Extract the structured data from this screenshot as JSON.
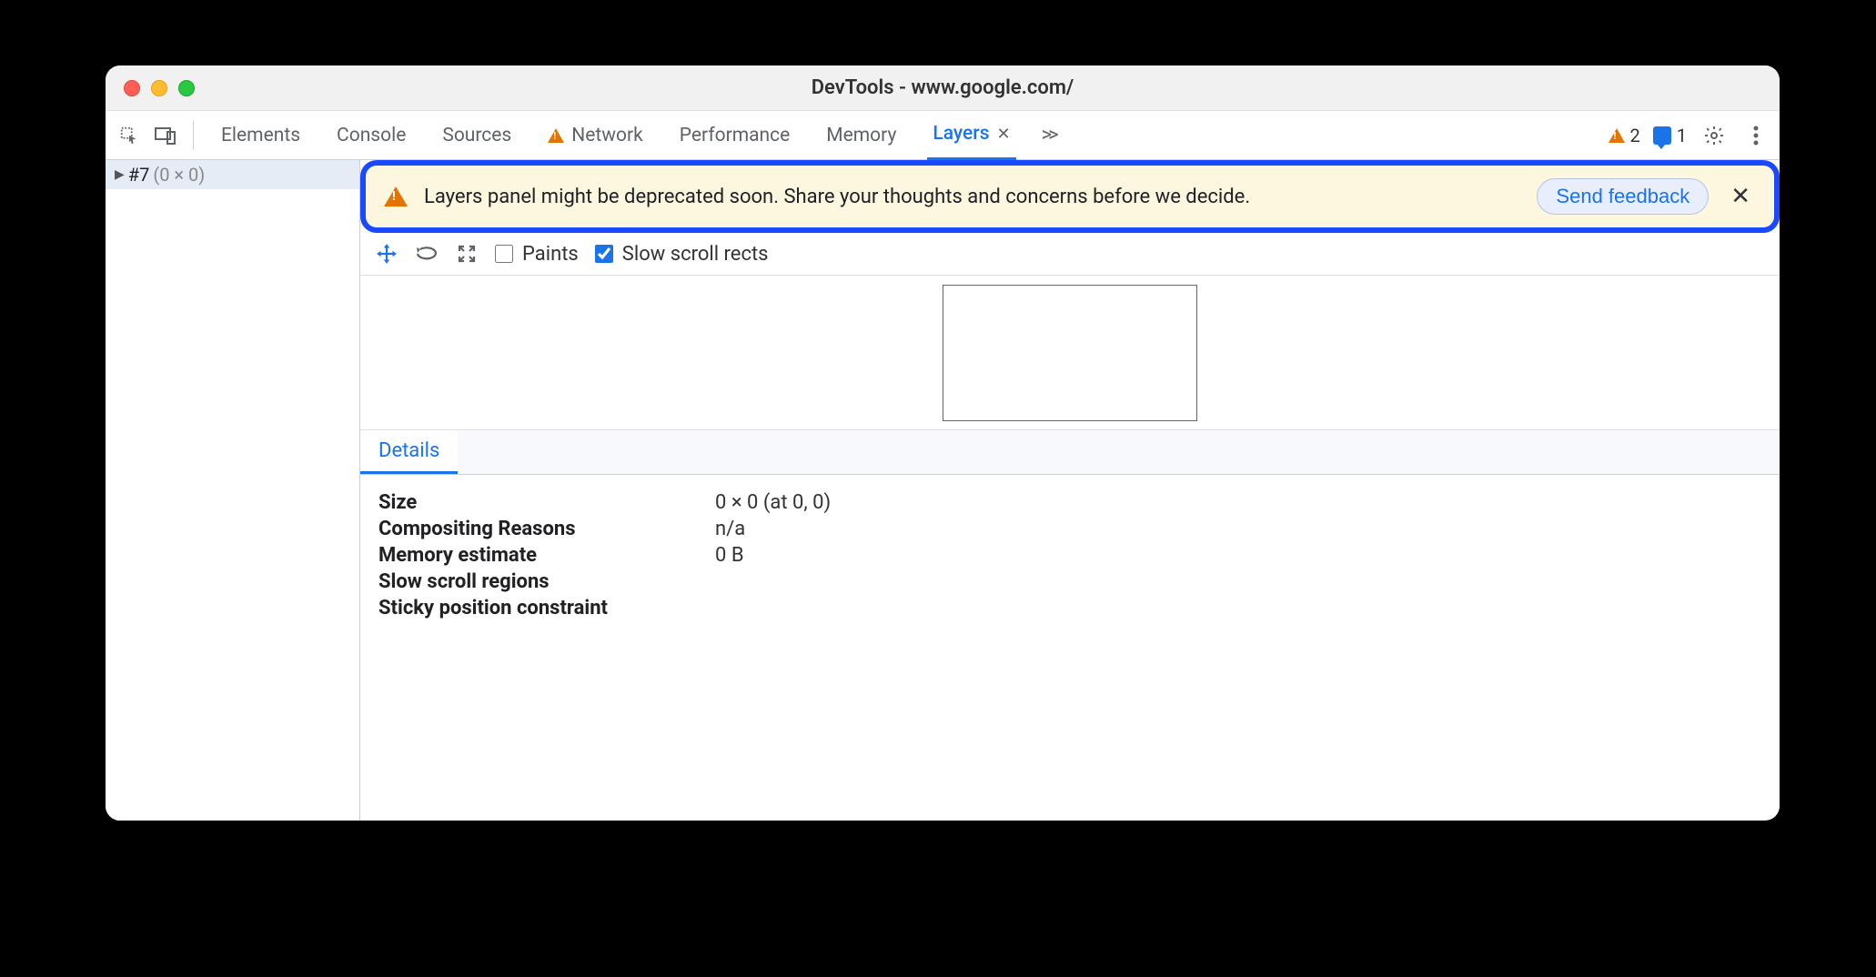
{
  "window": {
    "title": "DevTools - www.google.com/"
  },
  "tabs": {
    "elements": "Elements",
    "console": "Console",
    "sources": "Sources",
    "network": "Network",
    "performance": "Performance",
    "memory": "Memory",
    "layers": "Layers"
  },
  "toolbarRight": {
    "warnings": "2",
    "messages": "1"
  },
  "tree": {
    "row0": {
      "label": "#7",
      "dims": "(0 × 0)"
    }
  },
  "banner": {
    "text": "Layers panel might be deprecated soon. Share your thoughts and concerns before we decide.",
    "button": "Send feedback"
  },
  "layerToolbar": {
    "paints": "Paints",
    "slowScroll": "Slow scroll rects"
  },
  "detailsTab": "Details",
  "details": {
    "size_k": "Size",
    "size_v": "0 × 0 (at 0, 0)",
    "comp_k": "Compositing Reasons",
    "comp_v": "n/a",
    "mem_k": "Memory estimate",
    "mem_v": "0 B",
    "slow_k": "Slow scroll regions",
    "slow_v": "",
    "sticky_k": "Sticky position constraint",
    "sticky_v": ""
  }
}
